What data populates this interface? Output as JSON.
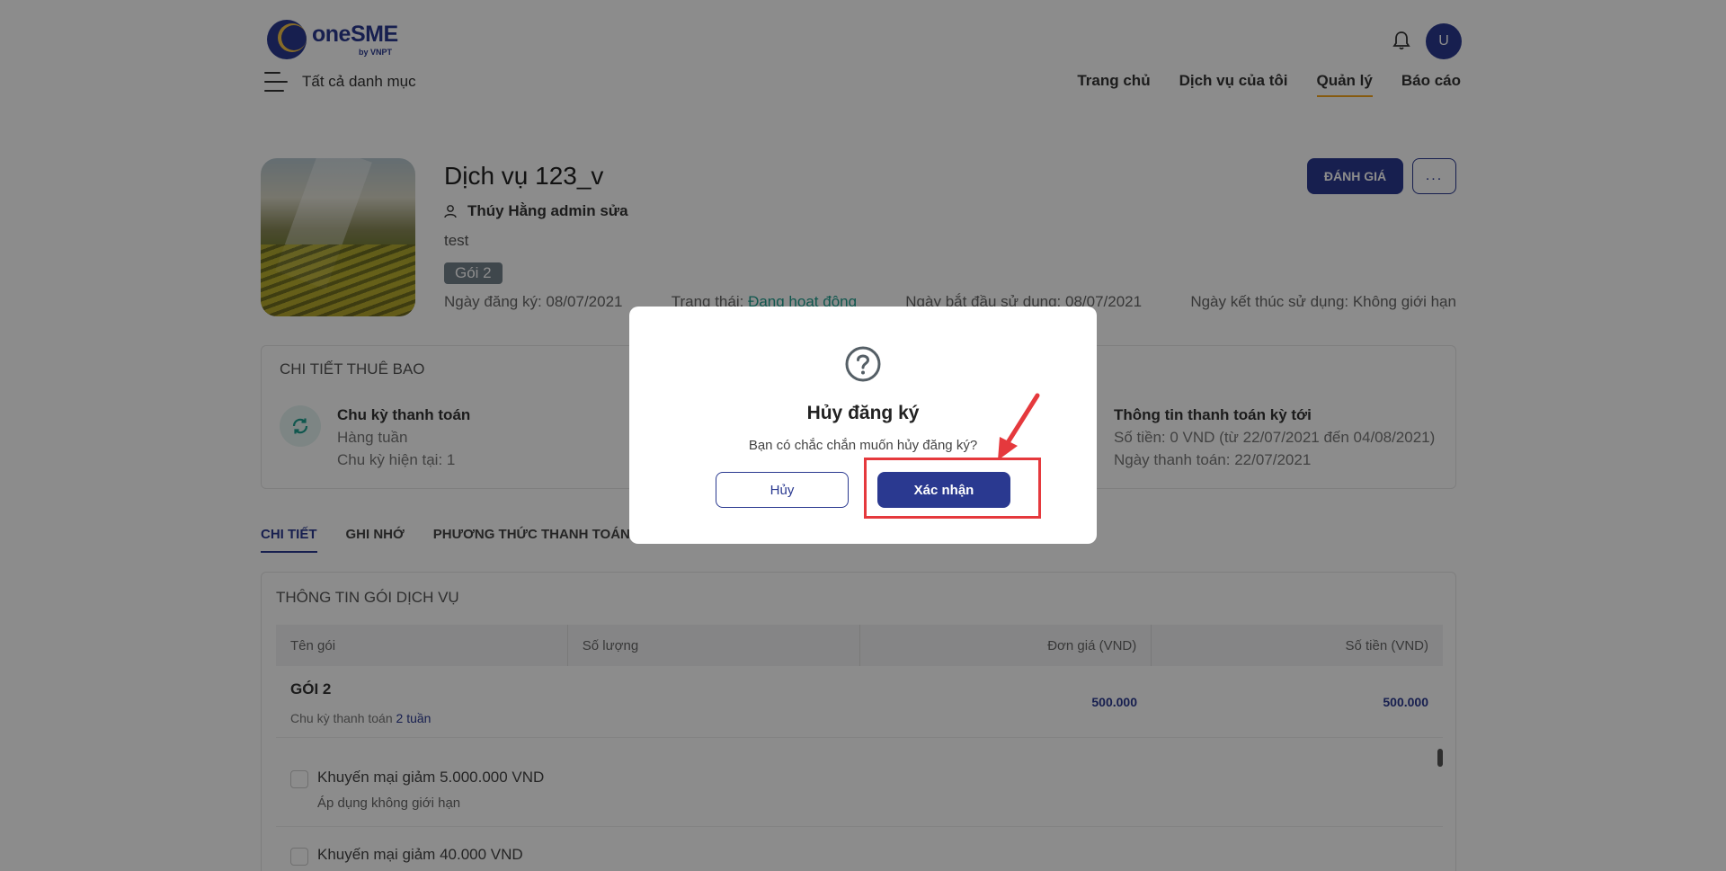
{
  "header": {
    "logo_name": "oneSME",
    "logo_sub": "by VNPT",
    "menu_label": "Tất cả danh mục",
    "avatar_initial": "U",
    "nav": [
      "Trang chủ",
      "Dịch vụ của tôi",
      "Quản lý",
      "Báo cáo"
    ],
    "nav_active": "Quản lý"
  },
  "service": {
    "title": "Dịch vụ 123_v",
    "owner": "Thúy Hằng admin sửa",
    "description": "test",
    "package_badge": "Gói 2",
    "reg_date": "Ngày đăng ký: 08/07/2021",
    "status_label": "Trạng thái: ",
    "status_value": "Đang hoạt động",
    "start_date": "Ngày bắt đầu sử dụng: 08/07/2021",
    "end_date": "Ngày kết thúc sử dụng: Không giới hạn",
    "review_button": "ĐÁNH GIÁ",
    "more_button": "..."
  },
  "subscription": {
    "title": "CHI TIẾT THUÊ BAO",
    "cycle": {
      "title": "Chu kỳ thanh toán",
      "line1": "Hàng tuần",
      "line2": "Chu kỳ hiện tại: 1"
    },
    "next_payment": {
      "title": "Thông tin thanh toán kỳ tới",
      "line1": "Số tiền: 0 VND (từ 22/07/2021 đến 04/08/2021)",
      "line2": "Ngày thanh toán: 22/07/2021"
    }
  },
  "tabs": [
    "CHI TIẾT",
    "GHI NHỚ",
    "PHƯƠNG THỨC THANH TOÁN"
  ],
  "package_info": {
    "title": "THÔNG TIN GÓI DỊCH VỤ",
    "columns": [
      "Tên gói",
      "Số lượng",
      "Đơn giá (VND)",
      "Số tiền (VND)"
    ],
    "row": {
      "name": "GÓI 2",
      "cycle_prefix": "Chu kỳ thanh toán ",
      "cycle_value": "2 tuần",
      "unit_price": "500.000",
      "amount": "500.000"
    },
    "promotions": [
      {
        "label": "Khuyến mại giảm 5.000.000 VND",
        "sub": "Áp dụng không giới hạn"
      },
      {
        "label": "Khuyến mại giảm 40.000 VND",
        "sub": ""
      }
    ]
  },
  "modal": {
    "title": "Hủy đăng ký",
    "message": "Bạn có chắc chắn muốn hủy đăng ký?",
    "cancel_label": "Hủy",
    "confirm_label": "Xác nhận"
  },
  "colors": {
    "brand": "#2a3990",
    "accent": "#f4a51c",
    "status_ok": "#1e9e8f",
    "annotation": "#e5393d"
  }
}
